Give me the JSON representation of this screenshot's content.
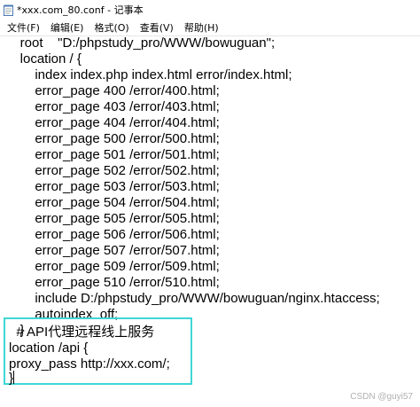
{
  "window": {
    "title": "*xxx.com_80.conf - 记事本",
    "icon": "notepad-icon"
  },
  "menu": {
    "items": [
      "文件(F)",
      "编辑(E)",
      "格式(O)",
      "查看(V)",
      "帮助(H)"
    ]
  },
  "editor": {
    "lines": [
      "    root    \"D:/phpstudy_pro/WWW/bowuguan\";",
      "    location / {",
      "        index index.php index.html error/index.html;",
      "        error_page 400 /error/400.html;",
      "        error_page 403 /error/403.html;",
      "        error_page 404 /error/404.html;",
      "        error_page 500 /error/500.html;",
      "        error_page 501 /error/501.html;",
      "        error_page 502 /error/502.html;",
      "        error_page 503 /error/503.html;",
      "        error_page 504 /error/504.html;",
      "        error_page 505 /error/505.html;",
      "        error_page 506 /error/506.html;",
      "        error_page 507 /error/507.html;",
      "        error_page 509 /error/509.html;",
      "        error_page 510 /error/510.html;",
      "        include D:/phpstudy_pro/WWW/bowuguan/nginx.htaccess;",
      "        autoindex  off;",
      "    }",
      "",
      "  # API代理远程线上服务",
      "location /api {",
      "proxy_pass http://xxx.com/;",
      "}"
    ]
  },
  "watermark": "CSDN @guyi57",
  "colors": {
    "highlight_border": "#3ed6d6"
  }
}
